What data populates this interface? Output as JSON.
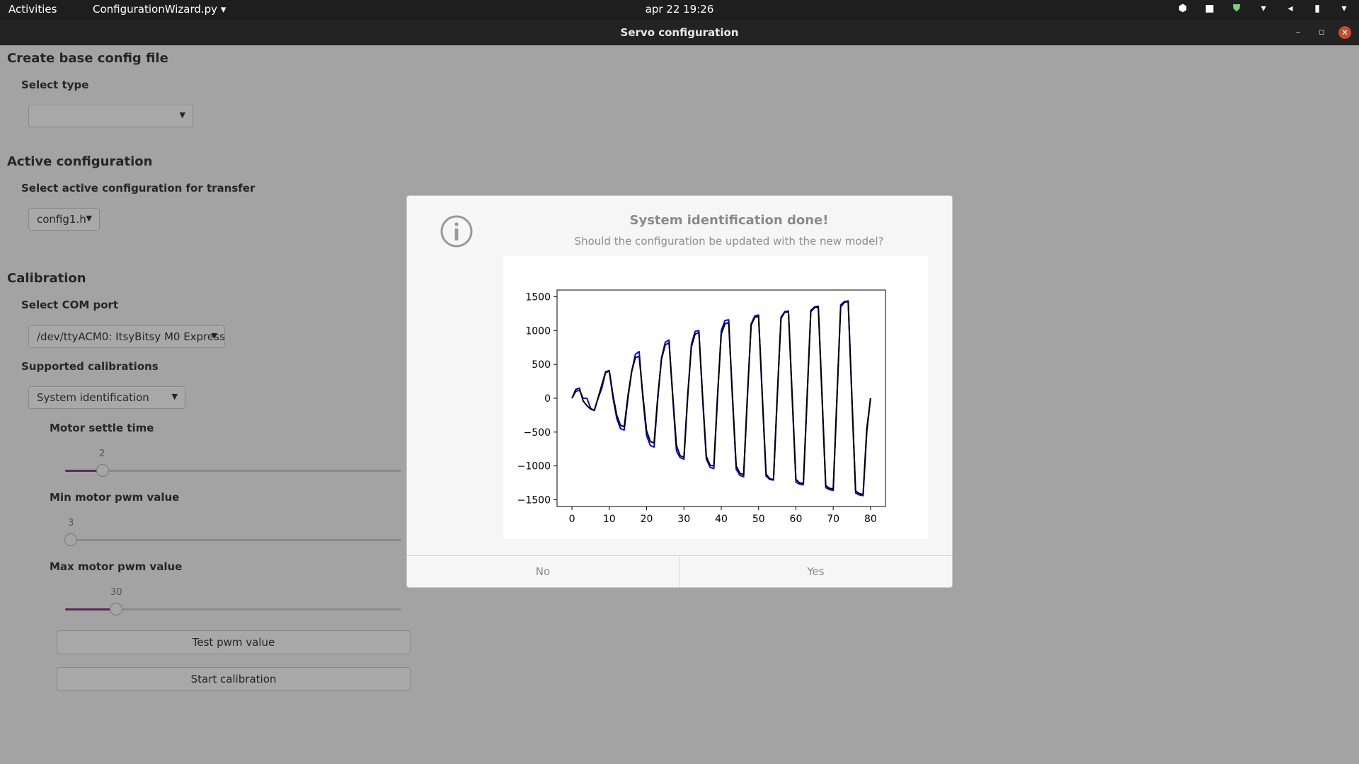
{
  "topbar": {
    "activities": "Activities",
    "app_menu": "ConfigurationWizard.py ▾",
    "clock": "apr 22  19:26",
    "tray_icons": [
      "dropbox-icon",
      "camera-icon",
      "shield-icon",
      "wifi-icon",
      "volume-icon",
      "battery-icon",
      "chevron-down-icon"
    ]
  },
  "window": {
    "title": "Servo configuration"
  },
  "sections": {
    "base": {
      "heading": "Create base config file",
      "label": "Select type",
      "value": ""
    },
    "active": {
      "heading": "Active configuration",
      "label": "Select active configuration for transfer",
      "value": "config1.h"
    },
    "calibration": {
      "heading": "Calibration",
      "com_label": "Select COM port",
      "com_value": "/dev/ttyACM0: ItsyBitsy M0 Express",
      "supported_label": "Supported calibrations",
      "supported_value": "System identification",
      "sliders": [
        {
          "label": "Motor settle time",
          "value": "2",
          "fraction": 0.093
        },
        {
          "label": "Min motor pwm value",
          "value": "3",
          "fraction": 0.0
        },
        {
          "label": "Max motor pwm value",
          "value": "30",
          "fraction": 0.13
        }
      ],
      "test_button": "Test pwm value",
      "start_button": "Start calibration"
    }
  },
  "dialog": {
    "title": "System identification done!",
    "subtitle": "Should the configuration be updated with the new model?",
    "no_label": "No",
    "yes_label": "Yes"
  },
  "chart_data": {
    "type": "line",
    "title": "",
    "xlabel": "",
    "ylabel": "",
    "xlim": [
      -4,
      84
    ],
    "ylim": [
      -1600,
      1600
    ],
    "xticks": [
      "0",
      "10",
      "20",
      "30",
      "40",
      "50",
      "60",
      "70",
      "80"
    ],
    "yticks": [
      "1500",
      "1000",
      "500",
      "0",
      "−500",
      "−1000",
      "−1500"
    ],
    "colors": [
      "#0000ff",
      "#000000"
    ],
    "series": [
      {
        "x": [
          0,
          1,
          2,
          3,
          4,
          5,
          6,
          7,
          8,
          9,
          10,
          11,
          12,
          13,
          14,
          15,
          16,
          17,
          18,
          19,
          20,
          21,
          22,
          23,
          24,
          25,
          26,
          27,
          28,
          29,
          30,
          31,
          32,
          33,
          34,
          35,
          36,
          37,
          38,
          39,
          40,
          41,
          42,
          43,
          44,
          45,
          46,
          47,
          48,
          49,
          50,
          51,
          52,
          53,
          54,
          55,
          56,
          57,
          58,
          59,
          60,
          61,
          62,
          63,
          64,
          65,
          66,
          67,
          68,
          69,
          70,
          71,
          72,
          73,
          74,
          75,
          76,
          77,
          78,
          79,
          80
        ],
        "values": [
          0,
          100,
          120,
          0,
          0,
          -150,
          -180,
          0,
          150,
          380,
          400,
          0,
          -300,
          -450,
          -470,
          0,
          400,
          650,
          690,
          0,
          -550,
          -700,
          -720,
          0,
          600,
          830,
          860,
          0,
          -780,
          -880,
          -900,
          0,
          800,
          990,
          1000,
          0,
          -900,
          -1020,
          -1040,
          0,
          1000,
          1150,
          1160,
          0,
          -1050,
          -1140,
          -1160,
          0,
          1100,
          1220,
          1230,
          0,
          -1150,
          -1200,
          -1210,
          0,
          1200,
          1280,
          1290,
          0,
          -1240,
          -1270,
          -1280,
          0,
          1300,
          1350,
          1360,
          0,
          -1320,
          -1350,
          -1360,
          0,
          1380,
          1430,
          1440,
          0,
          -1400,
          -1430,
          -1440,
          -500,
          0
        ]
      },
      {
        "x": [
          0,
          1,
          2,
          3,
          4,
          5,
          6,
          7,
          8,
          9,
          10,
          11,
          12,
          13,
          14,
          15,
          16,
          17,
          18,
          19,
          20,
          21,
          22,
          23,
          24,
          25,
          26,
          27,
          28,
          29,
          30,
          31,
          32,
          33,
          34,
          35,
          36,
          37,
          38,
          39,
          40,
          41,
          42,
          43,
          44,
          45,
          46,
          47,
          48,
          49,
          50,
          51,
          52,
          53,
          54,
          55,
          56,
          57,
          58,
          59,
          60,
          61,
          62,
          63,
          64,
          65,
          66,
          67,
          68,
          69,
          70,
          71,
          72,
          73,
          74,
          75,
          76,
          77,
          78,
          79,
          80
        ],
        "values": [
          0,
          130,
          150,
          -40,
          -110,
          -160,
          -180,
          10,
          200,
          390,
          410,
          40,
          -250,
          -400,
          -420,
          40,
          400,
          600,
          620,
          40,
          -480,
          -640,
          -660,
          40,
          580,
          790,
          820,
          40,
          -700,
          -850,
          -870,
          40,
          760,
          950,
          970,
          40,
          -860,
          -990,
          -1000,
          40,
          950,
          1100,
          1120,
          40,
          -1000,
          -1110,
          -1130,
          40,
          1080,
          1200,
          1210,
          40,
          -1120,
          -1190,
          -1200,
          40,
          1180,
          1270,
          1280,
          40,
          -1200,
          -1250,
          -1260,
          40,
          1280,
          1340,
          1350,
          40,
          -1290,
          -1330,
          -1340,
          40,
          1350,
          1420,
          1430,
          40,
          -1370,
          -1410,
          -1420,
          -450,
          0
        ]
      }
    ]
  }
}
